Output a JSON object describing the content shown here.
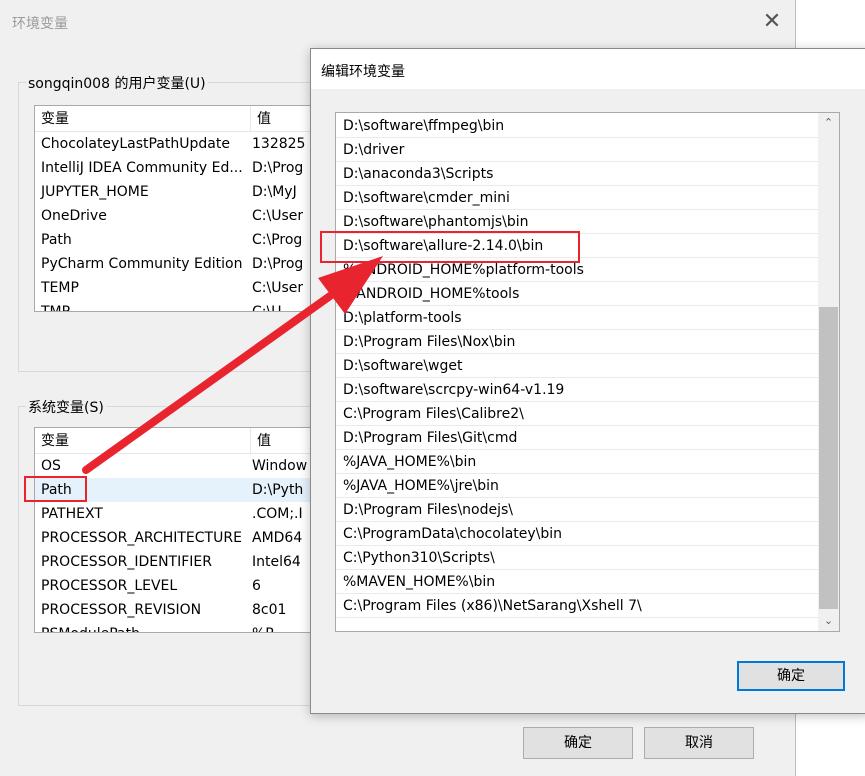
{
  "env_dialog": {
    "title": "环境变量",
    "close_glyph": "✕",
    "user_group_label": "songqin008 的用户变量(U)",
    "user_table": {
      "headers": [
        "变量",
        "值"
      ],
      "rows": [
        [
          "ChocolateyLastPathUpdate",
          "132825"
        ],
        [
          "IntelliJ IDEA Community Ed...",
          "D:\\Prog"
        ],
        [
          "JUPYTER_HOME",
          "D:\\MyJ"
        ],
        [
          "OneDrive",
          "C:\\User"
        ],
        [
          "Path",
          "C:\\Prog"
        ],
        [
          "PyCharm Community Edition",
          "D:\\Prog"
        ],
        [
          "TEMP",
          "C:\\User"
        ],
        [
          "TMP",
          "C:\\U"
        ]
      ]
    },
    "system_group_label": "系统变量(S)",
    "system_table": {
      "headers": [
        "变量",
        "值"
      ],
      "rows": [
        [
          "OS",
          "Window"
        ],
        [
          "Path",
          "D:\\Pyth"
        ],
        [
          "PATHEXT",
          ".COM;.I"
        ],
        [
          "PROCESSOR_ARCHITECTURE",
          "AMD64"
        ],
        [
          "PROCESSOR_IDENTIFIER",
          "Intel64"
        ],
        [
          "PROCESSOR_LEVEL",
          "6"
        ],
        [
          "PROCESSOR_REVISION",
          "8c01"
        ],
        [
          "PSModulePath",
          "%P"
        ]
      ],
      "selected_index": 1
    },
    "ok_label": "确定",
    "cancel_label": "取消"
  },
  "edit_dialog": {
    "title": "编辑环境变量",
    "path_entries": [
      "D:\\software\\ffmpeg\\bin",
      "D:\\driver",
      "D:\\anaconda3\\Scripts",
      "D:\\software\\cmder_mini",
      "D:\\software\\phantomjs\\bin",
      "D:\\software\\allure-2.14.0\\bin",
      "%ANDROID_HOME%platform-tools",
      "%ANDROID_HOME%tools",
      "D:\\platform-tools",
      "D:\\Program Files\\Nox\\bin",
      "D:\\software\\wget",
      "D:\\software\\scrcpy-win64-v1.19",
      "C:\\Program Files\\Calibre2\\",
      "D:\\Program Files\\Git\\cmd",
      "%JAVA_HOME%\\bin",
      "%JAVA_HOME%\\jre\\bin",
      "D:\\Program Files\\nodejs\\",
      "C:\\ProgramData\\chocolatey\\bin",
      "C:\\Python310\\Scripts\\",
      "%MAVEN_HOME%\\bin",
      "C:\\Program Files (x86)\\NetSarang\\Xshell 7\\"
    ],
    "highlighted_entry_index": 5,
    "ok_label": "确定",
    "scroll_up_glyph": "⌃",
    "scroll_down_glyph": "⌄"
  },
  "annotation": {
    "color": "#e8242f",
    "from": "system path row",
    "to": "allure path entry"
  }
}
